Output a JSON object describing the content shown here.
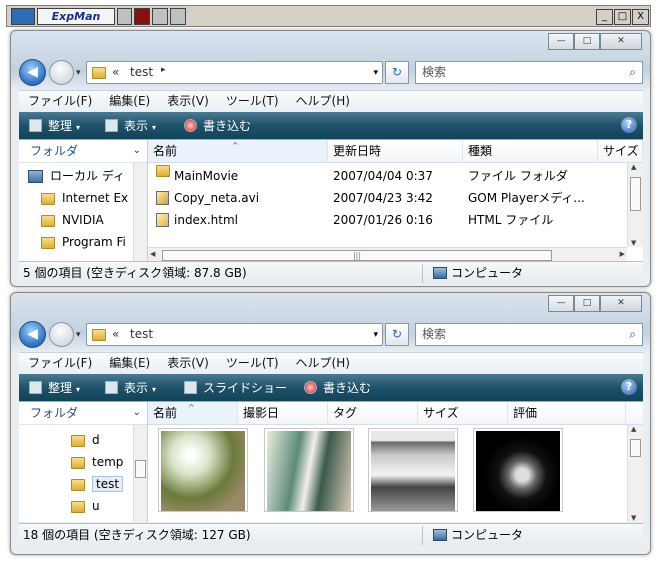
{
  "app_bar": {
    "title": "ExpMan",
    "min": "_",
    "max": "□",
    "close": "X"
  },
  "window1": {
    "address": {
      "chevron": "«",
      "path": "test",
      "arrow": "▸"
    },
    "search_placeholder": "検索",
    "menu": [
      "ファイル(F)",
      "編集(E)",
      "表示(V)",
      "ツール(T)",
      "ヘルプ(H)"
    ],
    "toolbar": {
      "organize": "整理",
      "view": "表示",
      "burn": "書き込む"
    },
    "folders_label": "フォルダ",
    "tree": [
      "ローカル ディ",
      "Internet Ex",
      "NVIDIA",
      "Program Fi"
    ],
    "columns": [
      "名前",
      "更新日時",
      "種類",
      "サイズ"
    ],
    "files": [
      {
        "name": "MainMovie",
        "date": "2007/04/04 0:37",
        "type": "ファイル フォルダ",
        "icon": "folder-icon"
      },
      {
        "name": "Copy_neta.avi",
        "date": "2007/04/23 3:42",
        "type": "GOM Playerメディ...",
        "icon": "avi-file-icon"
      },
      {
        "name": "index.html",
        "date": "2007/01/26 0:16",
        "type": "HTML ファイル",
        "icon": "html-file-icon"
      }
    ],
    "status": "5 個の項目 (空きディスク領域: 87.8 GB)",
    "status_location": "コンピュータ",
    "scroll_up": "▲",
    "scroll_down": "▼",
    "scroll_left": "◀",
    "scroll_right": "▶",
    "scroll_grip": "|||"
  },
  "window2": {
    "address": {
      "chevron": "«",
      "path": "test"
    },
    "search_placeholder": "検索",
    "menu": [
      "ファイル(F)",
      "編集(E)",
      "表示(V)",
      "ツール(T)",
      "ヘルプ(H)"
    ],
    "toolbar": {
      "organize": "整理",
      "view": "表示",
      "slideshow": "スライドショー",
      "burn": "書き込む"
    },
    "folders_label": "フォルダ",
    "tree": [
      "d",
      "temp",
      "test",
      "u"
    ],
    "columns": [
      "名前",
      "撮影日",
      "タグ",
      "サイズ",
      "評価"
    ],
    "status": "18 個の項目 (空きディスク領域: 127 GB)",
    "status_location": "コンピュータ",
    "scroll_up": "▲",
    "scroll_down": "▼"
  },
  "window_buttons": {
    "min": "—",
    "max": "□",
    "close": "✕"
  },
  "glyphs": {
    "back": "◀",
    "dropdown": "▾",
    "refresh": "↻",
    "search": "⌕",
    "help": "?",
    "sort": "^",
    "chevron_down": "⌄"
  }
}
